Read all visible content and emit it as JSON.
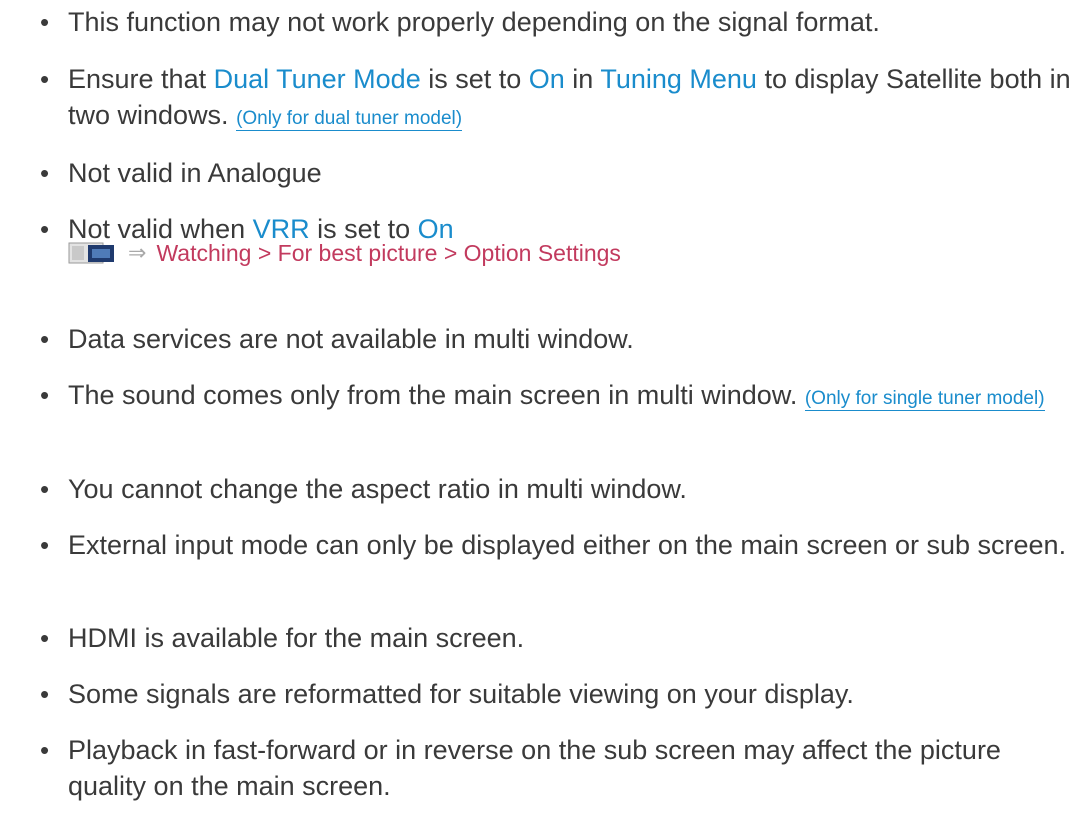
{
  "bullet_glyph": "•",
  "colors": {
    "text": "#3a3a3a",
    "link": "#1a8ccc",
    "crossref": "#c23a5e"
  },
  "items": [
    {
      "text": "This function may not work properly depending on the signal format."
    },
    {
      "part1": "Ensure that ",
      "link1": "Dual Tuner Mode",
      "part2": " is set to ",
      "link2": "On",
      "part3": " in ",
      "link3": "Tuning Menu",
      "part4": " to display Satellite both in two windows. ",
      "note": "(Only for dual tuner model)"
    },
    {
      "text": "Not valid in Analogue"
    },
    {
      "part1": "Not valid when ",
      "link1": "VRR",
      "part2": " is set to ",
      "link2": "On"
    },
    {
      "text": "Data services are not available in multi window."
    },
    {
      "text": "The sound comes only from the main screen in multi window. ",
      "note": "(Only for single tuner model)"
    },
    {
      "text": "You cannot change the aspect ratio in multi window."
    },
    {
      "text": "External input mode can only be displayed either on the main screen or sub screen."
    },
    {
      "text": "HDMI is available for the main screen."
    },
    {
      "text": "Some signals are reformatted for suitable viewing on your display."
    },
    {
      "text": "Playback in fast-forward or in reverse on the sub screen may affect the picture quality on the main screen."
    }
  ],
  "crossref": {
    "icon": "tv-menu-icon",
    "arrow_icon": "arrow-icon",
    "path": "Watching > For best picture > Option Settings"
  }
}
